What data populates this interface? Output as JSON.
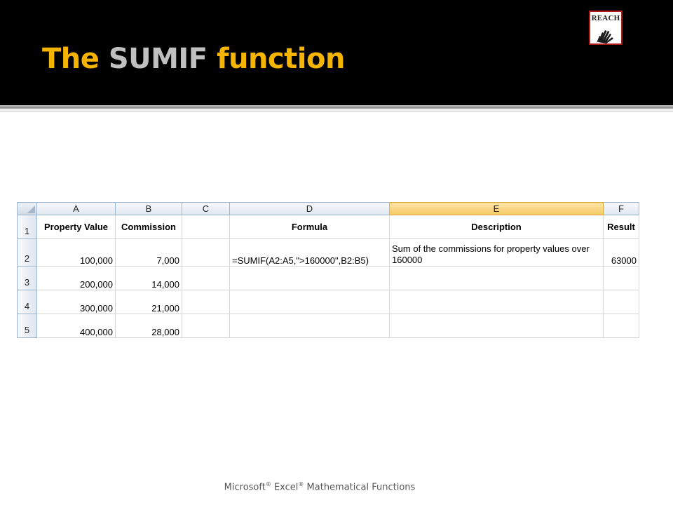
{
  "slide": {
    "title_parts": [
      "The ",
      "SUMIF",
      " function"
    ],
    "logo_text": "REACH",
    "footer": {
      "brand1": "Microsoft",
      "reg": "®",
      "brand2": " Excel",
      "reg2": "®",
      "rest": " Mathematical Functions"
    }
  },
  "spreadsheet": {
    "column_headers": [
      "A",
      "B",
      "C",
      "D",
      "E",
      "F"
    ],
    "selected_column": "E",
    "row_numbers": [
      "1",
      "2",
      "3",
      "4",
      "5"
    ],
    "rows": [
      [
        "Property Value",
        "Commission",
        "",
        "Formula",
        "Description",
        "Result"
      ],
      [
        "100,000",
        "7,000",
        "",
        "=SUMIF(A2:A5,\">160000\",B2:B5)",
        "Sum of the commissions for property values over 160000",
        "63000"
      ],
      [
        "200,000",
        "14,000",
        "",
        "",
        "",
        ""
      ],
      [
        "300,000",
        "21,000",
        "",
        "",
        "",
        ""
      ],
      [
        "400,000",
        "28,000",
        "",
        "",
        "",
        ""
      ]
    ]
  },
  "colors": {
    "title_accent": "#f4b400",
    "title_keyword": "#c0c0c0",
    "selected_header": "#f7c866"
  }
}
